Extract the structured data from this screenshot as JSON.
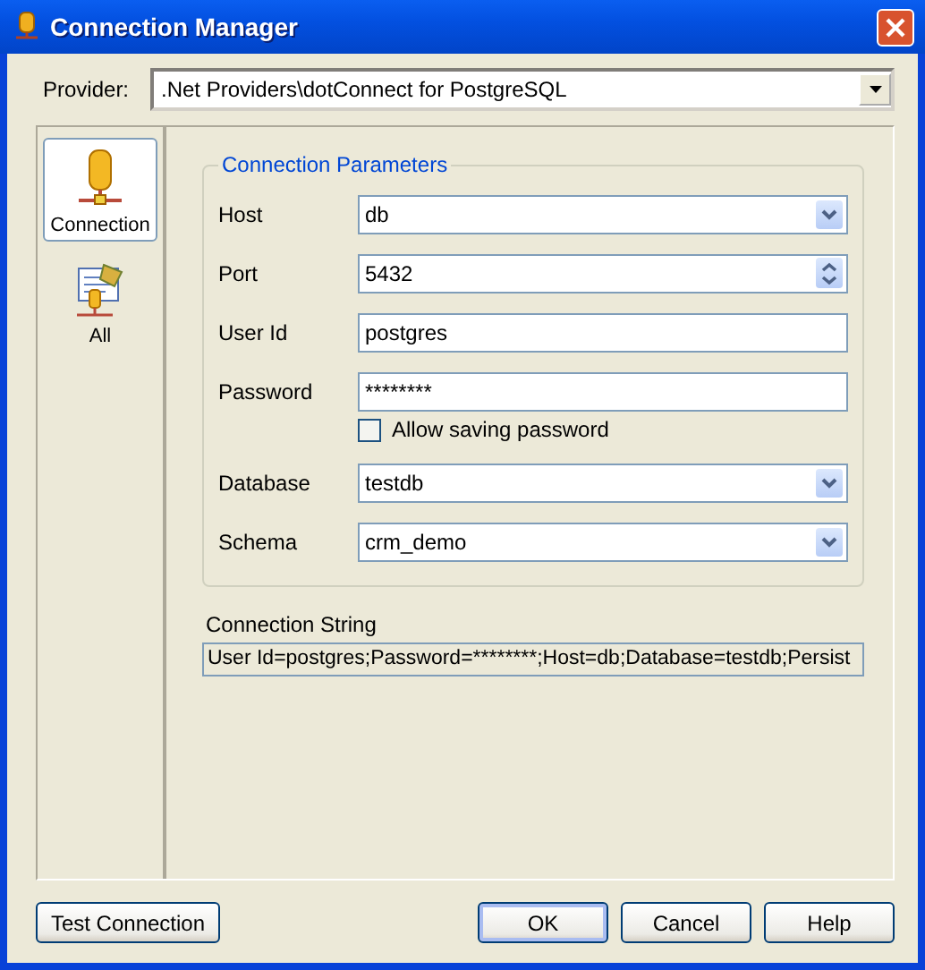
{
  "window": {
    "title": "Connection Manager"
  },
  "provider": {
    "label": "Provider:",
    "value": ".Net Providers\\dotConnect for PostgreSQL"
  },
  "sidebar": {
    "items": [
      {
        "label": "Connection",
        "kind": "connection",
        "selected": true
      },
      {
        "label": "All",
        "kind": "all",
        "selected": false
      }
    ]
  },
  "group": {
    "title": "Connection Parameters",
    "fields": [
      {
        "kind": "combo",
        "label": "Host",
        "value": "db"
      },
      {
        "kind": "spin",
        "label": "Port",
        "value": "5432"
      },
      {
        "kind": "text",
        "label": "User Id",
        "value": "postgres"
      },
      {
        "kind": "text",
        "label": "Password",
        "value": "********"
      },
      {
        "kind": "checkbox",
        "label": "Allow saving password",
        "checked": false
      },
      {
        "kind": "combo",
        "label": "Database",
        "value": "testdb"
      },
      {
        "kind": "combo",
        "label": "Schema",
        "value": "crm_demo"
      }
    ]
  },
  "connection_string": {
    "label": "Connection String",
    "value": "User Id=postgres;Password=********;Host=db;Database=testdb;Persist"
  },
  "buttons": [
    {
      "label": "Test Connection",
      "kind": "left",
      "default": false
    },
    {
      "label": "OK",
      "kind": "right",
      "default": true
    },
    {
      "label": "Cancel",
      "kind": "right",
      "default": false
    },
    {
      "label": "Help",
      "kind": "right",
      "default": false
    }
  ]
}
